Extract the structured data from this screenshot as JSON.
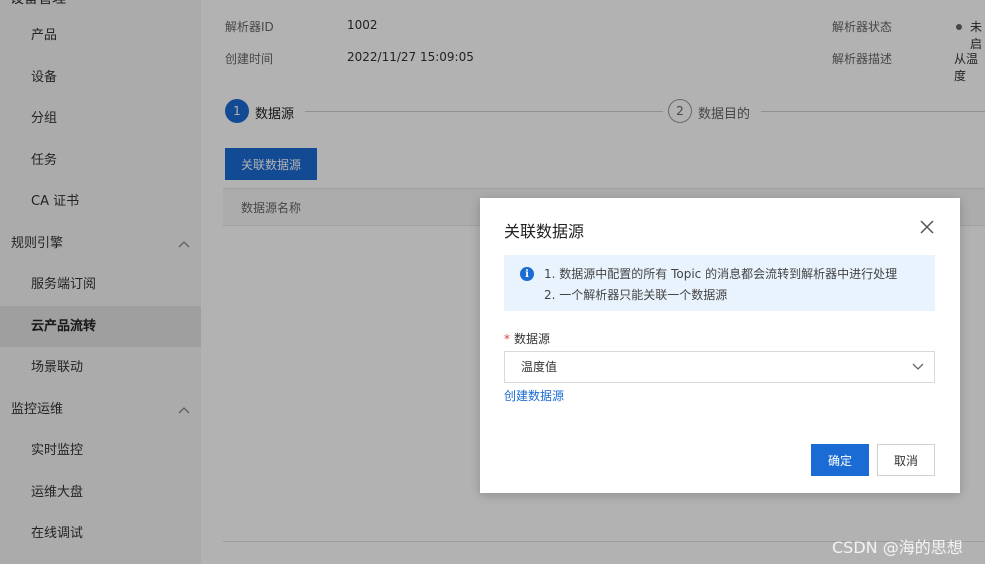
{
  "sidebar": {
    "top_cut_label": "设备管理",
    "items": [
      {
        "label": "产品"
      },
      {
        "label": "设备"
      },
      {
        "label": "分组"
      },
      {
        "label": "任务"
      },
      {
        "label": "CA 证书"
      }
    ],
    "group_rules": "规则引擎",
    "rules_items": [
      {
        "label": "服务端订阅"
      },
      {
        "label": "云产品流转"
      },
      {
        "label": "场景联动"
      }
    ],
    "group_ops": "监控运维",
    "ops_items": [
      {
        "label": "实时监控"
      },
      {
        "label": "运维大盘"
      },
      {
        "label": "在线调试"
      }
    ]
  },
  "info": {
    "parser_id_label": "解析器ID",
    "parser_id_value": "1002",
    "created_label": "创建时间",
    "created_value": "2022/11/27 15:09:05",
    "status_label": "解析器状态",
    "status_value": "未启",
    "desc_label": "解析器描述",
    "desc_value": "从温度"
  },
  "steps": [
    {
      "num": "1",
      "label": "数据源"
    },
    {
      "num": "2",
      "label": "数据目的"
    }
  ],
  "main": {
    "associate_btn": "关联数据源",
    "table_header": "数据源名称"
  },
  "dialog": {
    "title": "关联数据源",
    "alert_line1": "1. 数据源中配置的所有 Topic 的消息都会流转到解析器中进行处理",
    "alert_line2": "2. 一个解析器只能关联一个数据源",
    "field_label": "数据源",
    "required_mark": "*",
    "select_value": "温度值",
    "create_link": "创建数据源",
    "ok": "确定",
    "cancel": "取消"
  },
  "watermark": "CSDN @海的思想",
  "colors": {
    "primary": "#1a6bd3",
    "alert_bg": "#e8f3fd",
    "sidebar_bg": "#f5f5f5",
    "required": "#e0443a"
  }
}
